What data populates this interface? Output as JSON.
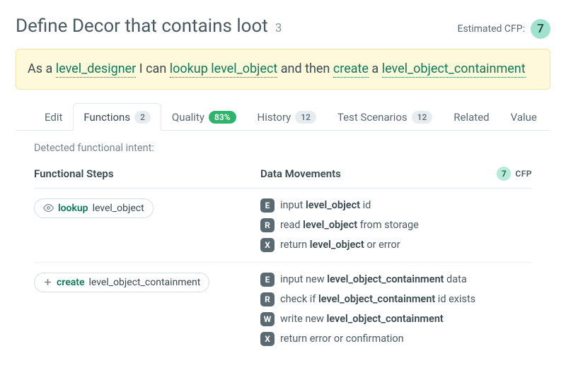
{
  "header": {
    "title": "Define Decor that contains loot",
    "title_id": "3",
    "cfp_label": "Estimated CFP:",
    "cfp_value": "7"
  },
  "story": {
    "prefix": "As a ",
    "role": "level_designer",
    "mid1": " I can ",
    "action1": "lookup level_object",
    "mid2": " and then ",
    "action2": "create",
    "mid3": " a ",
    "action3": "level_object_containment"
  },
  "tabs": {
    "edit": "Edit",
    "functions": "Functions",
    "functions_count": "2",
    "quality": "Quality",
    "quality_pct": "83%",
    "history": "History",
    "history_count": "12",
    "scenarios": "Test Scenarios",
    "scenarios_count": "12",
    "related": "Related",
    "value": "Value"
  },
  "section": {
    "intent": "Detected functional intent:",
    "col_steps": "Functional Steps",
    "col_movements": "Data Movements",
    "cfp_small": "7",
    "cfp_small_label": "CFP"
  },
  "steps": [
    {
      "icon": "eye",
      "verb": "lookup",
      "object": "level_object",
      "movements": [
        {
          "code": "E",
          "pre": "input ",
          "bold": "level_object",
          "post": " id"
        },
        {
          "code": "R",
          "pre": "read ",
          "bold": "level_object",
          "post": " from storage"
        },
        {
          "code": "X",
          "pre": "return ",
          "bold": "level_object",
          "post": " or error"
        }
      ]
    },
    {
      "icon": "plus",
      "verb": "create",
      "object": "level_object_containment",
      "movements": [
        {
          "code": "E",
          "pre": "input new ",
          "bold": "level_object_containment",
          "post": " data"
        },
        {
          "code": "R",
          "pre": "check if ",
          "bold": "level_object_containment",
          "post": " id exists"
        },
        {
          "code": "W",
          "pre": "write new ",
          "bold": "level_object_containment",
          "post": ""
        },
        {
          "code": "X",
          "pre": "return error or confirmation",
          "bold": "",
          "post": ""
        }
      ]
    }
  ]
}
